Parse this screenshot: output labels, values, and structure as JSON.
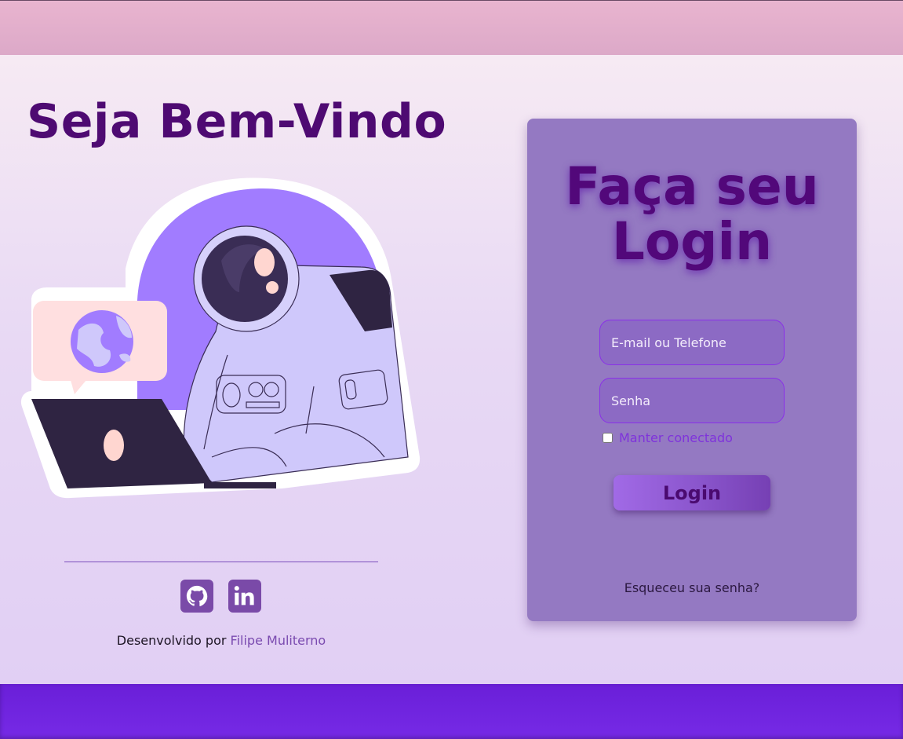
{
  "header": {},
  "welcome": {
    "title": "Seja Bem-Vindo"
  },
  "footer": {
    "credits_prefix": "Desenvolvido por",
    "author": "Filipe Muliterno",
    "social": [
      {
        "icon": "github-icon"
      },
      {
        "icon": "linkedin-icon"
      }
    ]
  },
  "login": {
    "title_line1": "Faça seu",
    "title_line2": "Login",
    "email_placeholder": "E-mail ou Telefone",
    "password_placeholder": "Senha",
    "remember_label": "Manter conectado",
    "remember_checked": false,
    "submit_label": "Login",
    "forgot_label": "Esqueceu sua senha?"
  },
  "colors": {
    "title": "#4e0a72",
    "card": "#9479c2",
    "accent": "#762ae6",
    "top_bar": "#e4b1cd"
  }
}
